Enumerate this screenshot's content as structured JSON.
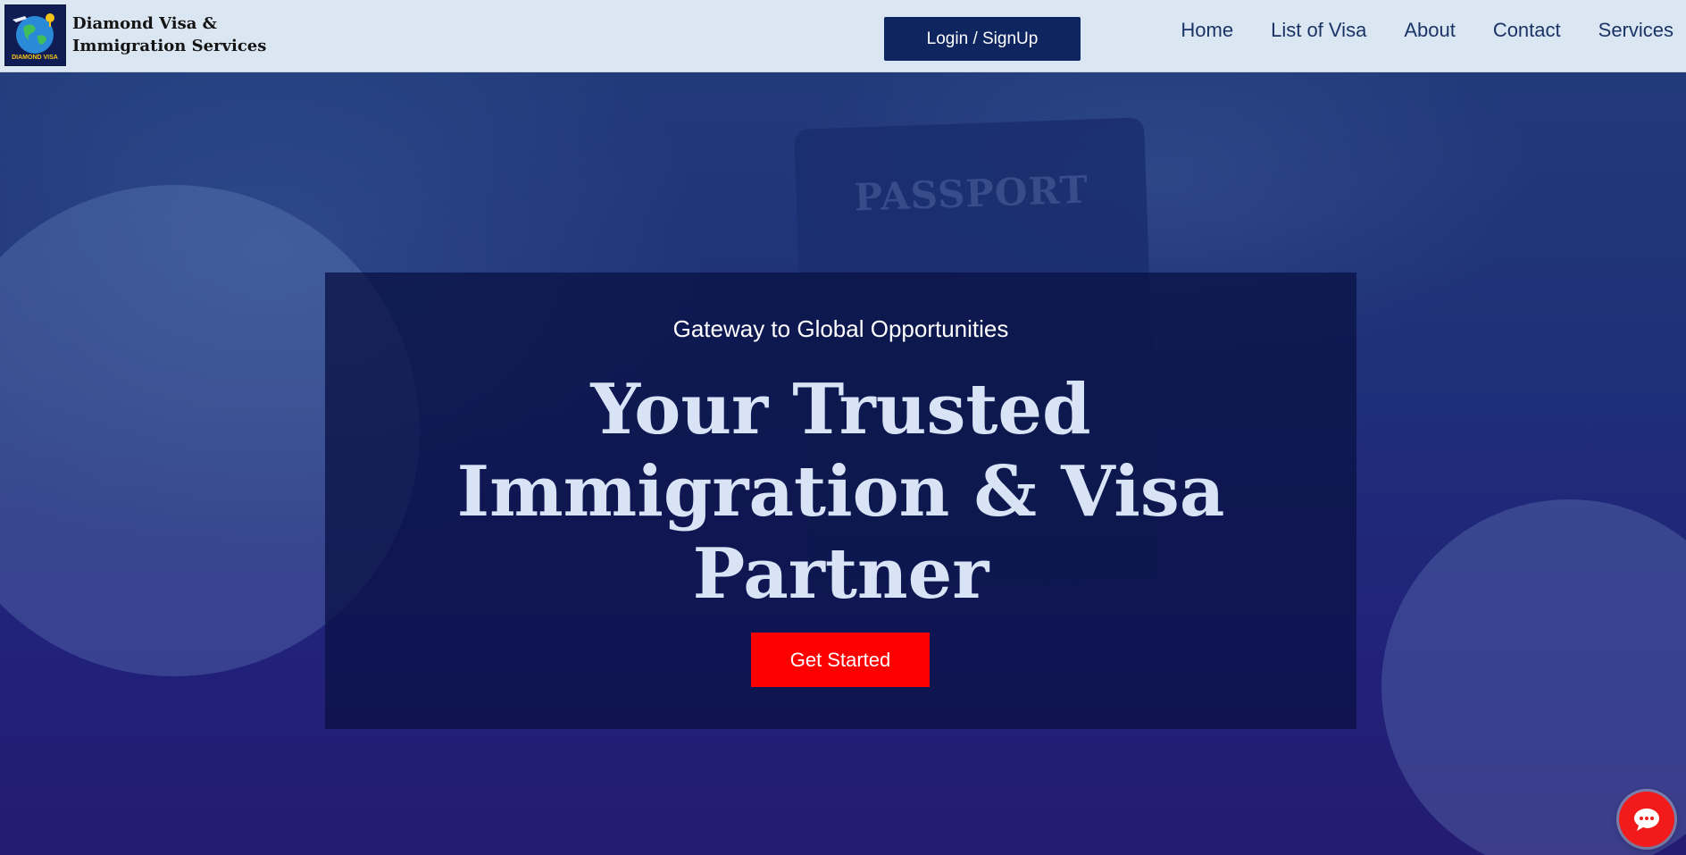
{
  "header": {
    "logo": {
      "caption": "DIAMOND VISA"
    },
    "brand_line1": "Diamond Visa &",
    "brand_line2": "Immigration Services",
    "login_label": "Login / SignUp",
    "nav": [
      "Home",
      "List of Visa",
      "About",
      "Contact",
      "Services"
    ]
  },
  "hero": {
    "background_text": "PASSPORT",
    "eyebrow": "Gateway to Global Opportunities",
    "headline_line1": "Your Trusted",
    "headline_line2": "Immigration & Visa",
    "headline_line3": "Partner",
    "cta_label": "Get Started"
  },
  "chat": {
    "icon": "chat-icon"
  },
  "colors": {
    "header_bg": "#dbe6f3",
    "primary": "#0e2560",
    "cta": "#ff0000",
    "headline": "#d8e4f6"
  }
}
